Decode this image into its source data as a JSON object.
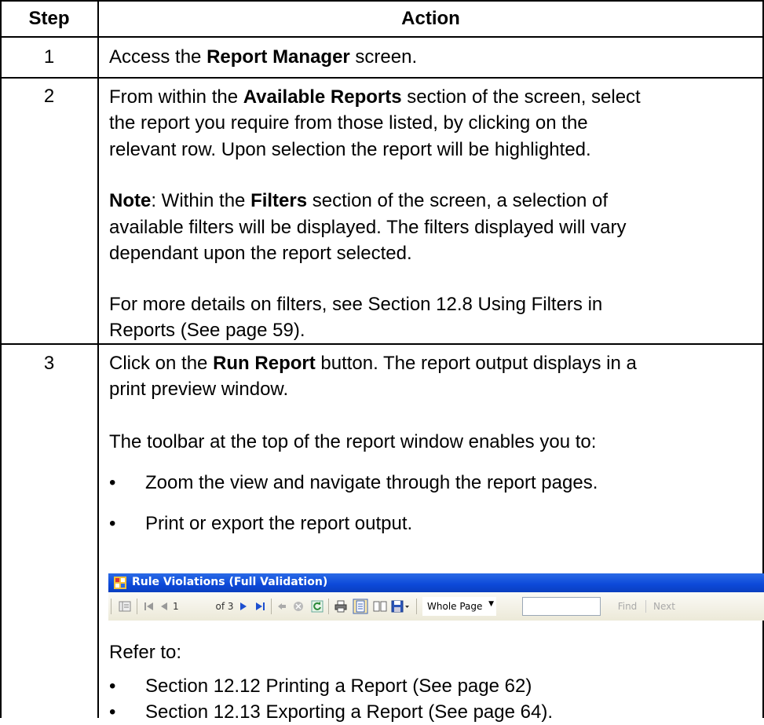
{
  "table": {
    "headers": {
      "step": "Step",
      "action": "Action"
    },
    "rows": [
      {
        "step": "1",
        "lines": [
          {
            "pre": "Access the ",
            "b": "Report Manager",
            "post": " screen."
          }
        ]
      },
      {
        "step": "2",
        "lines": [
          {
            "pre": "From within the ",
            "b": "Available Reports",
            "post": " section of the screen, select"
          },
          {
            "pre": "the report you require from those listed, by clicking on the",
            "b": "",
            "post": ""
          },
          {
            "pre": "relevant row. Upon selection the report will be highlighted.",
            "b": "",
            "post": ""
          },
          {
            "pre": "",
            "b": "Note",
            "post": ": Within the ",
            "b2": "Filters",
            "post2": " section of the screen, a selection of"
          },
          {
            "pre": "available filters will be displayed. The filters displayed will vary",
            "b": "",
            "post": ""
          },
          {
            "pre": "dependant upon the report selected.",
            "b": "",
            "post": ""
          },
          {
            "pre": "For more details on filters, see Section 12.8 Using Filters in",
            "b": "",
            "post": ""
          },
          {
            "pre": "Reports (See page 59).",
            "b": "",
            "post": ""
          }
        ]
      },
      {
        "step": "3",
        "lines": [
          {
            "pre": "Click on the ",
            "b": "Run Report",
            "post": " button. The report output displays in a"
          },
          {
            "pre": "print preview window.",
            "b": "",
            "post": ""
          },
          {
            "pre": "The toolbar at the top of the report window enables you to:",
            "b": "",
            "post": ""
          }
        ],
        "bullets": [
          "Zoom the view and navigate through the report pages.",
          "Print or export the report output."
        ],
        "refer_label": "Refer to:",
        "refer_bullets": [
          "Section 12.12 Printing a Report (See page 62)",
          "Section 12.13 Exporting a Report (See page 64)."
        ]
      }
    ]
  },
  "screenshot": {
    "window_title": "Rule Violations (Full Validation)",
    "page_current": "1",
    "page_of": "of 3",
    "zoom_value": "Whole Page",
    "find_label": "Find",
    "next_label": "Next",
    "bullet_char": "•"
  }
}
